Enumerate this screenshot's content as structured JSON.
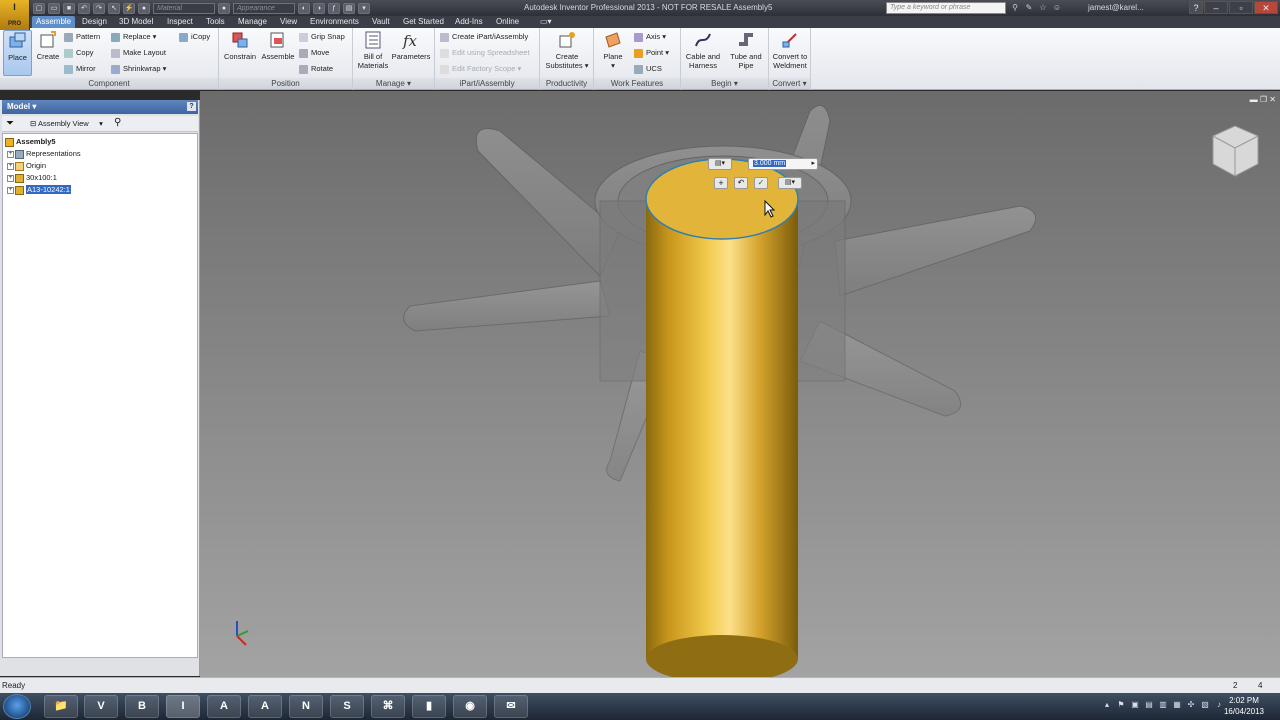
{
  "window": {
    "title": "Autodesk Inventor Professional 2013 - NOT FOR RESALE    Assembly5",
    "search_placeholder": "Type a keyword or phrase",
    "user": "jamest@karel...",
    "logo_text": "PRO",
    "material_placeholder": "Material",
    "appearance_placeholder": "Appearance"
  },
  "tabs": [
    "Assemble",
    "Design",
    "3D Model",
    "Inspect",
    "Tools",
    "Manage",
    "View",
    "Environments",
    "Vault",
    "Get Started",
    "Add-Ins",
    "Online"
  ],
  "active_tab": "Assemble",
  "ribbon": {
    "component": {
      "label": "Component",
      "place": "Place",
      "create": "Create",
      "pattern": "Pattern",
      "copy": "Copy",
      "mirror": "Mirror",
      "replace": "Replace",
      "make_layout": "Make Layout",
      "shrinkwrap": "Shrinkwrap",
      "icopy": "iCopy"
    },
    "position": {
      "label": "Position",
      "constrain": "Constrain",
      "assemble": "Assemble",
      "grip_snap": "Grip Snap",
      "move": "Move",
      "rotate": "Rotate"
    },
    "manage": {
      "label": "Manage",
      "bom_line1": "Bill of",
      "bom_line2": "Materials",
      "parameters": "Parameters"
    },
    "ipart": {
      "label": "iPart/iAssembly",
      "create": "Create iPart/iAssembly",
      "edit_spreadsheet": "Edit using Spreadsheet",
      "edit_factory": "Edit Factory Scope"
    },
    "productivity": {
      "label": "Productivity",
      "create_sub_line1": "Create",
      "create_sub_line2": "Substitutes"
    },
    "work_features": {
      "label": "Work Features",
      "plane": "Plane",
      "axis": "Axis",
      "point": "Point",
      "ucs": "UCS"
    },
    "begin": {
      "label": "Begin",
      "cable_line1": "Cable and",
      "cable_line2": "Harness",
      "tube_line1": "Tube and",
      "tube_line2": "Pipe"
    },
    "convert": {
      "label": "Convert",
      "weld_line1": "Convert to",
      "weld_line2": "Weldment"
    }
  },
  "browser": {
    "title": "Model",
    "view": "Assembly View",
    "tree": [
      {
        "label": "Assembly5",
        "bold": true
      },
      {
        "label": "Representations"
      },
      {
        "label": "Origin"
      },
      {
        "label": "30x100:1"
      },
      {
        "label": "A13-10242:1",
        "selected": true
      }
    ]
  },
  "viewport": {
    "dimension_value": "3.000 mm"
  },
  "status": {
    "text": "Ready",
    "count1": "2",
    "count2": "4"
  },
  "taskbar": {
    "time": "2:02 PM",
    "date": "16/04/2013",
    "apps": [
      "",
      "V",
      "B",
      "",
      "A",
      "A",
      "N",
      "S",
      "",
      "",
      "",
      ""
    ]
  }
}
